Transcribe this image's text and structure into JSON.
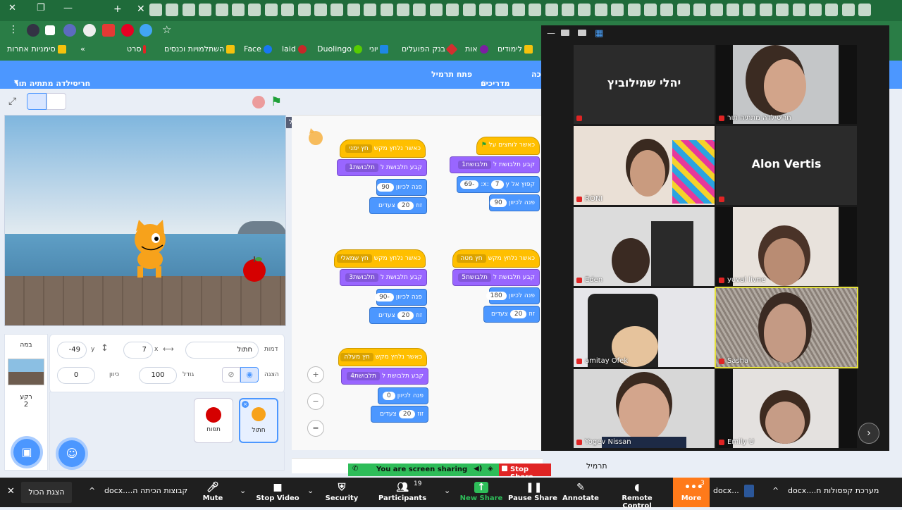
{
  "browser": {
    "bookmarks": [
      {
        "label": "סימניות אחרות",
        "color": "#f4c20d"
      },
      {
        "label": "»",
        "color": ""
      },
      {
        "label": "סרט",
        "color": "#e02424"
      },
      {
        "label": "השתלמויות וכנסים",
        "color": "#f4c20d"
      },
      {
        "label": "Face",
        "color": "#1877f2"
      },
      {
        "label": "laid",
        "color": "#c62828"
      },
      {
        "label": "Duolingo",
        "color": "#58cc02"
      },
      {
        "label": "יוני",
        "color": "#1e88e5"
      },
      {
        "label": "בנק הפועלים",
        "color": "#d32f2f"
      },
      {
        "label": "אות",
        "color": "#7b1fa2"
      },
      {
        "label": "לימודים",
        "color": "#f4c20d"
      }
    ]
  },
  "scratch": {
    "project_owner": "חריסילדה מתתיה תור",
    "header_items": {
      "tutorials": "מדריכים",
      "open_terminal": "פתח תרמיל",
      "edge": "כה"
    },
    "green_flag_tooltip": "הפעל",
    "blocks": {
      "when_key": "כאשר נלחץ מקש",
      "key_right": "חץ ימני",
      "key_left": "חץ שמאלי",
      "key_down": "חץ מטה",
      "key_up": "חץ מעלה",
      "when_flag": "כאשר לוחצים על",
      "switch_costume": "קבע תלבושת ל",
      "costume1": "תלבושת1",
      "costume2": "תלבושת2",
      "costume3": "תלבושת3",
      "costume4": "תלבושת4",
      "costume5": "תלבושת5",
      "point_dir": "פנה לכיוון",
      "move": "זוז",
      "steps": "צעדים",
      "goto": "קפוץ אל x:",
      "y_label": "y:",
      "v90": "90",
      "vm90": "-90",
      "v0": "0",
      "v180": "180",
      "v20": "20",
      "vm69": "-69",
      "v7": "7"
    },
    "sprite_info": {
      "sprite_label": "דמות",
      "sprite_name": "חתול",
      "x_label": "x",
      "x_value": "7",
      "y_label": "y",
      "y_value": "-49",
      "show_label": "הצגה",
      "size_label": "גודל",
      "size_value": "100",
      "dir_label": "כיוון",
      "dir_value": "0"
    },
    "sprites": [
      {
        "name": "חתול"
      },
      {
        "name": "תפוח"
      }
    ],
    "stage_pane": {
      "title": "במה",
      "backdrops_label": "רקע",
      "backdrop_count": "2"
    },
    "backpack_label": "תרמיל"
  },
  "zoom": {
    "participants": [
      {
        "name": "יהלי שמילוביץ",
        "video": false
      },
      {
        "name": "חריסילדה מתתיה תור",
        "video": true
      },
      {
        "name": "RONI",
        "video": true
      },
      {
        "name": "Alon Vertis",
        "video": false
      },
      {
        "name": "Eden",
        "video": true
      },
      {
        "name": "yuval livne",
        "video": true
      },
      {
        "name": "amitay Ofek",
        "video": true
      },
      {
        "name": "Sasha",
        "video": true
      },
      {
        "name": "Yogev Nissan",
        "video": true
      },
      {
        "name": "Emily U",
        "video": true
      }
    ],
    "sharing_banner": "You are screen sharing",
    "stop_share": "Stop Share",
    "toolbar": {
      "mute": "Mute",
      "stop_video": "Stop Video",
      "security": "Security",
      "participants": "Participants",
      "participants_count": "19",
      "new_share": "New Share",
      "pause_share": "Pause Share",
      "annotate": "Annotate",
      "remote_control": "Remote Control",
      "more": "More",
      "more_badge": "3"
    }
  },
  "taskbar": {
    "show_all": "הצגת הכול",
    "file1": "קבוצות הכיתה ה....docx",
    "file2": "docx...",
    "file3": "מערכת קפסולות ח....docx"
  }
}
